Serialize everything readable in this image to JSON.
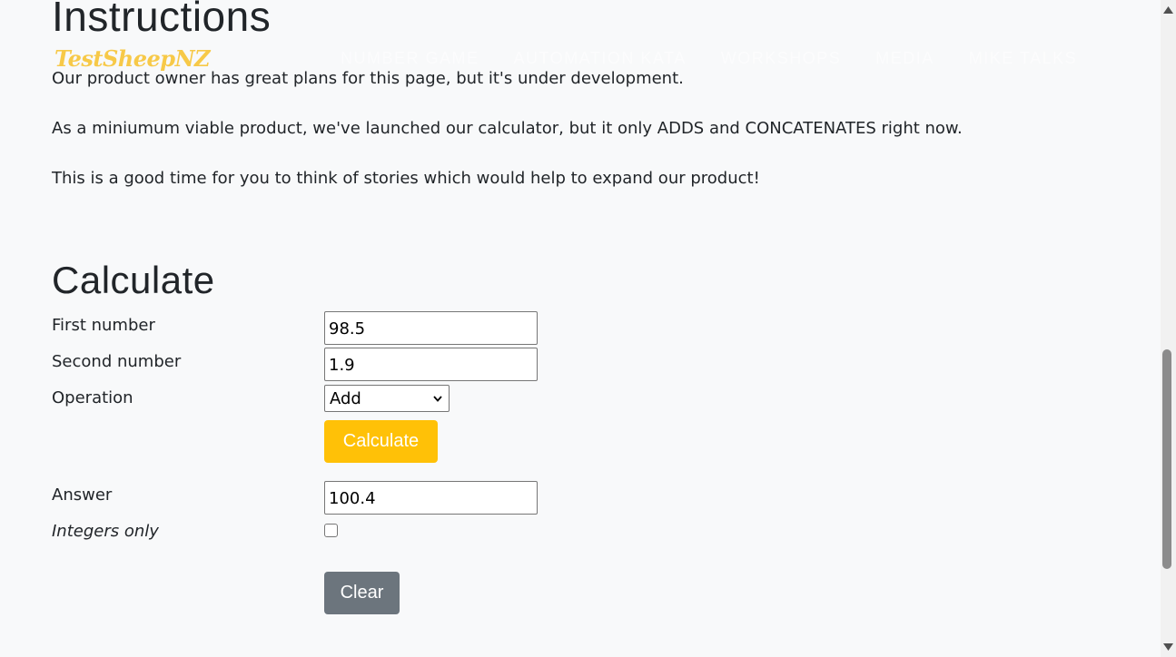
{
  "headings": {
    "instructions": "Instructions",
    "calculate": "Calculate"
  },
  "navbar": {
    "brand": "TestSheepNZ",
    "links": [
      "NUMBER GAME",
      "AUTOMATION KATA",
      "WORKSHOPS",
      "MEDIA",
      "MIKE TALKS"
    ]
  },
  "paragraphs": [
    "Our product owner has great plans for this page, but it's under development.",
    "As a miniumum viable product, we've launched our calculator, but it only ADDS and CONCATENATES right now.",
    "This is a good time for you to think of stories which would help to expand our product!"
  ],
  "form": {
    "first_label": "First number",
    "first_value": "98.5",
    "second_label": "Second number",
    "second_value": "1.9",
    "operation_label": "Operation",
    "operation_selected": "Add",
    "calculate_button": "Calculate",
    "answer_label": "Answer",
    "answer_value": "100.4",
    "integers_label": "Integers only",
    "integers_checked": false,
    "clear_button": "Clear"
  },
  "colors": {
    "page_bg": "#f8f9fa",
    "brand": "#f7c948",
    "calculate_button": "#ffc107",
    "clear_button": "#6c757d"
  },
  "icons": {
    "select_arrow": "chevron-down-icon",
    "scroll_up": "arrow-up-icon",
    "scroll_down": "arrow-down-icon"
  }
}
